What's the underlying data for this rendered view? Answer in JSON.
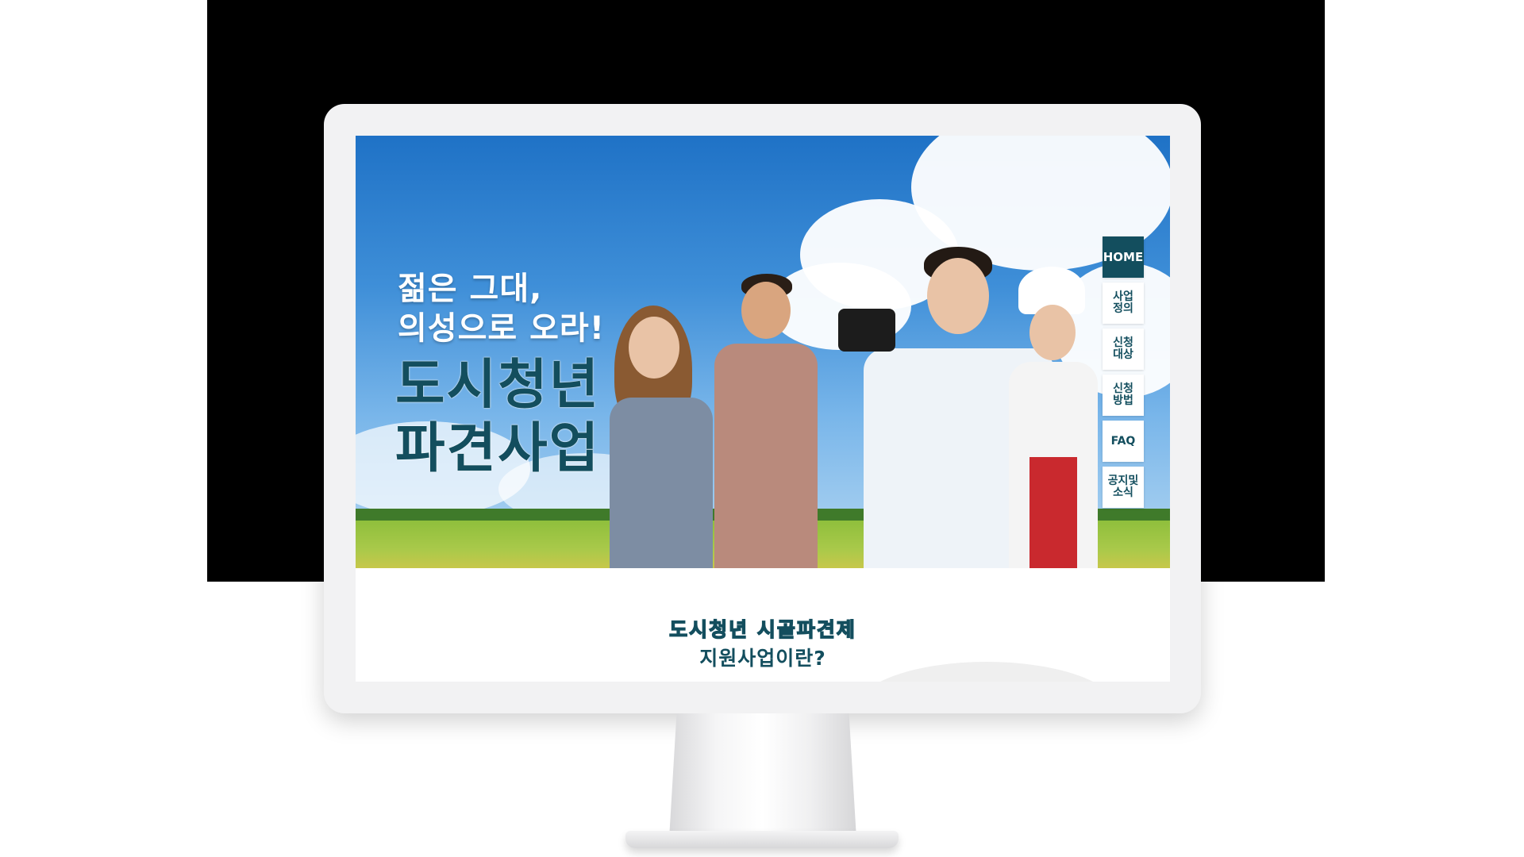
{
  "hero": {
    "tagline": [
      "젊은 그대,",
      "의성으로 오라!"
    ],
    "title": [
      "도시청년",
      "파견사업"
    ]
  },
  "nav": {
    "items": [
      {
        "label": "HOME",
        "active": true
      },
      {
        "label": "사업\n정의"
      },
      {
        "label": "신청\n대상"
      },
      {
        "label": "신청\n방법"
      },
      {
        "label": "FAQ"
      },
      {
        "label": "공지및\n소식"
      }
    ]
  },
  "intro": {
    "line1": "도시청년 시골파견제",
    "line2": "지원사업이란?"
  },
  "colors": {
    "brand_dark_teal": "#134e5e",
    "sky_blue": "#2f82d0"
  }
}
